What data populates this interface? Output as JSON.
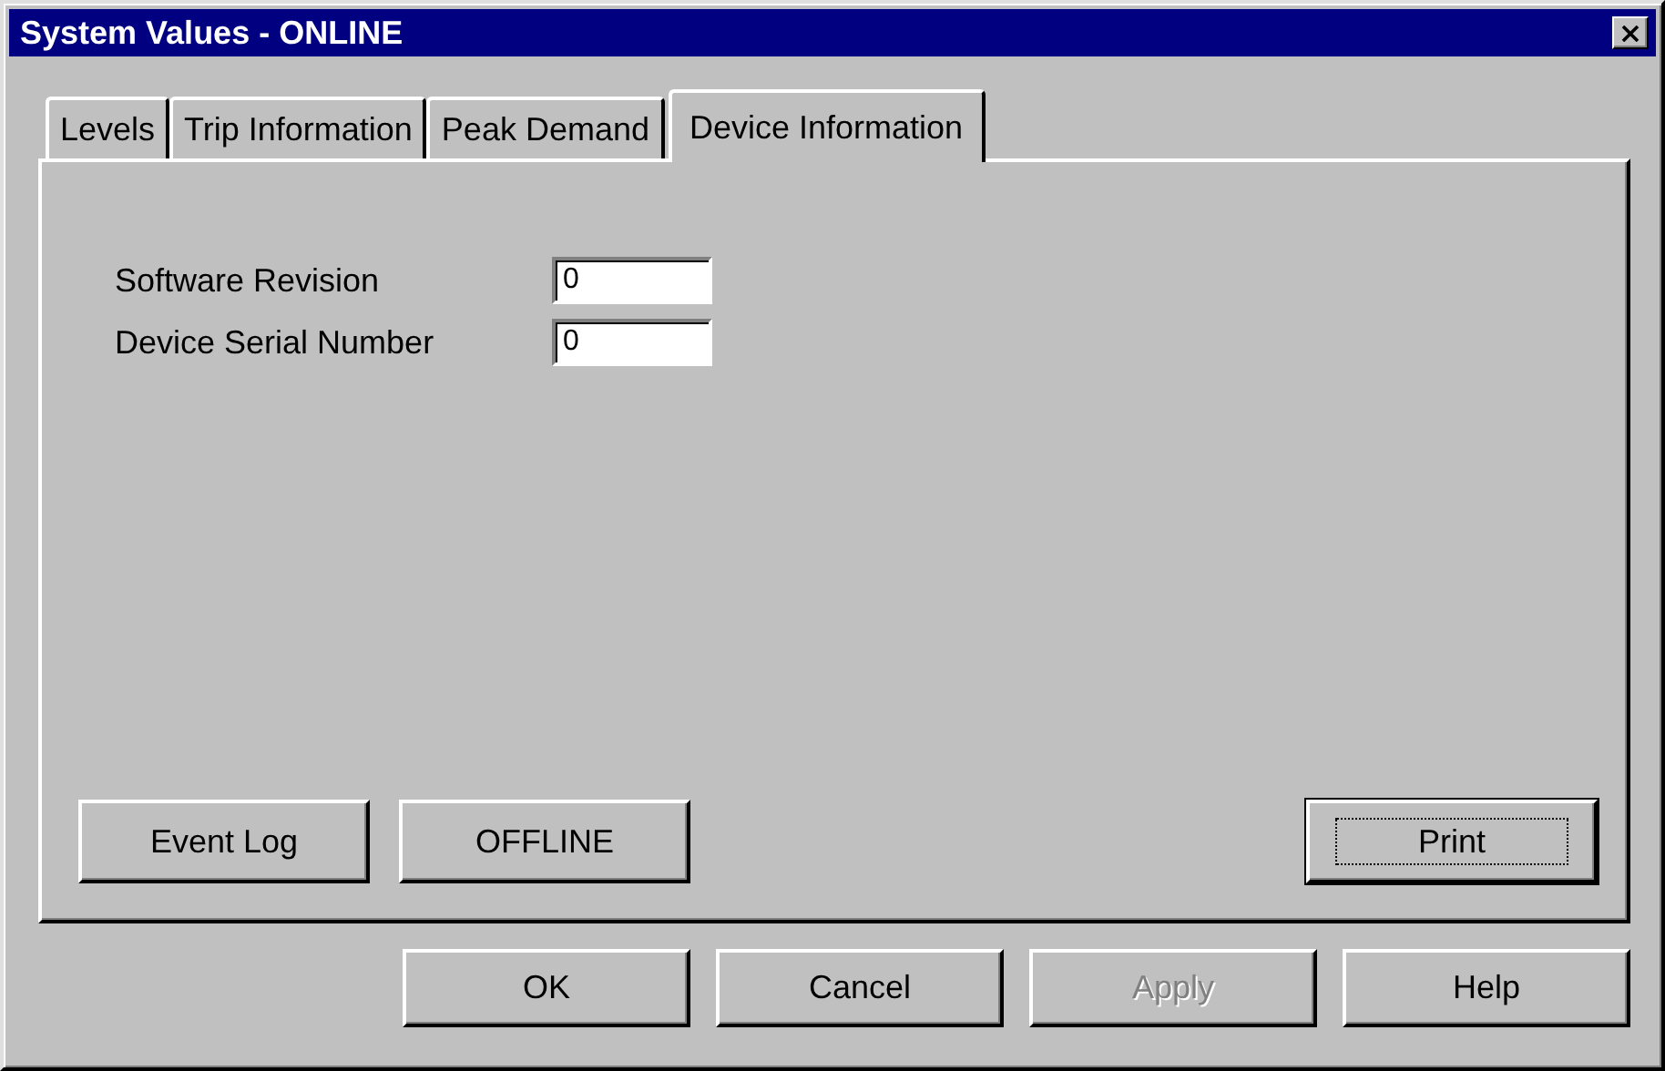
{
  "window": {
    "title": "System Values - ONLINE"
  },
  "tabs": [
    {
      "label": "Levels",
      "selected": false
    },
    {
      "label": "Trip Information",
      "selected": false
    },
    {
      "label": "Peak Demand",
      "selected": false
    },
    {
      "label": "Device Information",
      "selected": true
    }
  ],
  "fields": [
    {
      "label": "Software Revision",
      "value": "0"
    },
    {
      "label": "Device Serial Number",
      "value": "0"
    }
  ],
  "panel_buttons": [
    {
      "label": "Event Log",
      "default": false
    },
    {
      "label": "OFFLINE",
      "default": false
    },
    {
      "label": "Print",
      "default": true
    }
  ],
  "buttons": [
    {
      "label": "OK",
      "disabled": false
    },
    {
      "label": "Cancel",
      "disabled": false
    },
    {
      "label": "Apply",
      "disabled": true
    },
    {
      "label": "Help",
      "disabled": false
    }
  ]
}
